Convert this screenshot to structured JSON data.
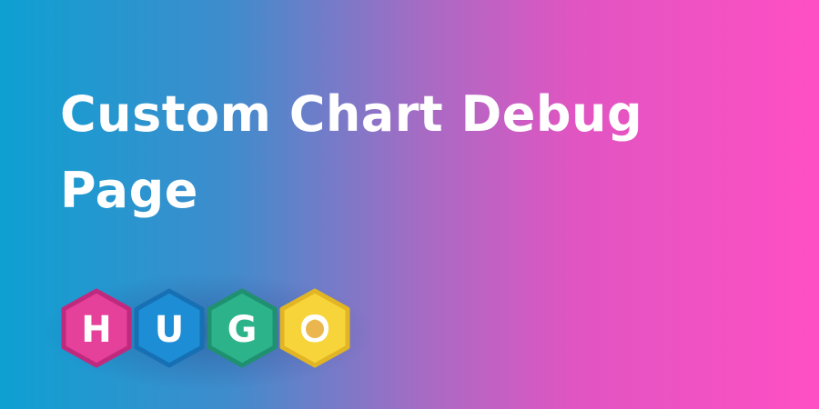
{
  "page": {
    "title": "Custom Chart Debug Page"
  },
  "logo": {
    "letters": [
      "H",
      "U",
      "G",
      "O"
    ],
    "colors": {
      "h": "#e5409a",
      "h_border": "#c02a7e",
      "u": "#1d8dd6",
      "u_border": "#1670b3",
      "g": "#2cb38a",
      "g_border": "#1f9070",
      "o": "#f7d43a",
      "o_border": "#e1b524",
      "o_inner": "#ecb64f"
    }
  }
}
